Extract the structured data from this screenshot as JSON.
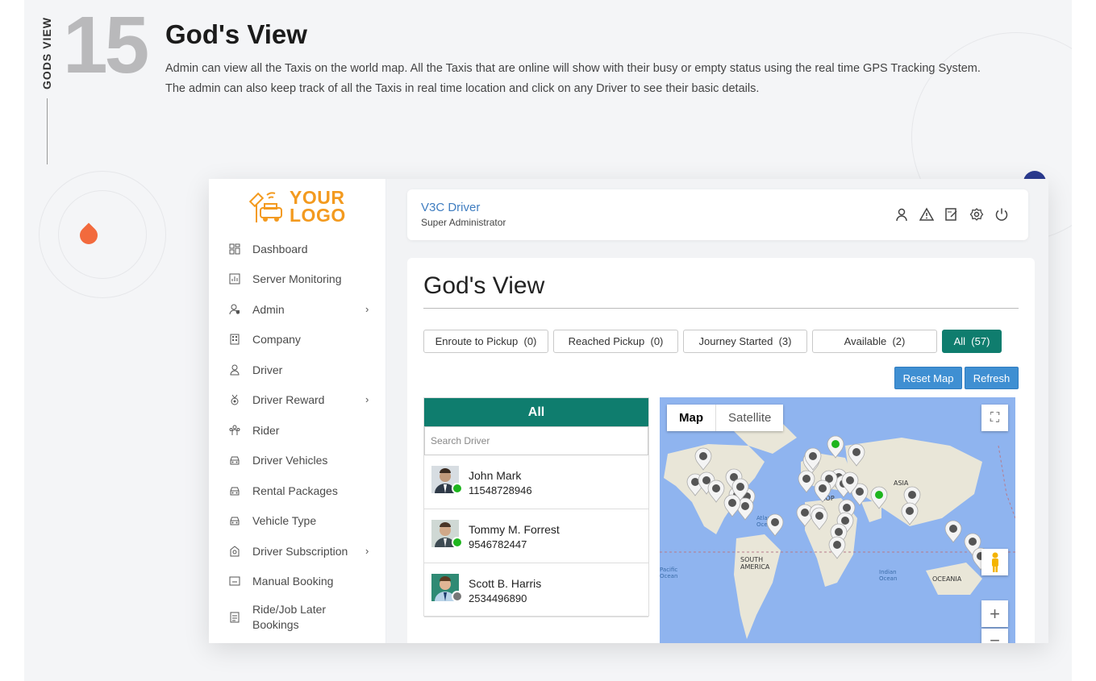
{
  "hero": {
    "side_label": "GODS VIEW",
    "number": "15",
    "title": "God's View",
    "description": "Admin can view all the Taxis on the world map. All the Taxis that are online will show with their busy or empty status using the real time GPS Tracking System. The admin can also keep track of all the Taxis in real time location and click on any Driver to see their basic details."
  },
  "logo": {
    "line1": "YOUR",
    "line2": "LOGO"
  },
  "sidebar": {
    "items": [
      {
        "label": "Dashboard",
        "icon": "dashboard-icon"
      },
      {
        "label": "Server Monitoring",
        "icon": "chart-icon"
      },
      {
        "label": "Admin",
        "icon": "admin-icon",
        "has_submenu": true
      },
      {
        "label": "Company",
        "icon": "building-icon"
      },
      {
        "label": "Driver",
        "icon": "driver-icon"
      },
      {
        "label": "Driver Reward",
        "icon": "medal-icon",
        "has_submenu": true
      },
      {
        "label": "Rider",
        "icon": "people-icon"
      },
      {
        "label": "Driver Vehicles",
        "icon": "car-icon"
      },
      {
        "label": "Rental Packages",
        "icon": "car-icon"
      },
      {
        "label": "Vehicle Type",
        "icon": "car-icon"
      },
      {
        "label": "Driver Subscription",
        "icon": "subscription-icon",
        "has_submenu": true
      },
      {
        "label": "Manual Booking",
        "icon": "booking-icon"
      },
      {
        "label": "Ride/Job Later Bookings",
        "icon": "document-icon"
      }
    ]
  },
  "topbar": {
    "user_name": "V3C Driver",
    "user_role": "Super Administrator"
  },
  "main": {
    "title": "God's View",
    "filters": [
      {
        "label": "Enroute to Pickup",
        "count": "(0)"
      },
      {
        "label": "Reached Pickup",
        "count": "(0)"
      },
      {
        "label": "Journey Started",
        "count": "(3)"
      },
      {
        "label": "Available",
        "count": "(2)"
      },
      {
        "label": "All",
        "count": "(57)"
      }
    ],
    "reset_map_label": "Reset Map",
    "refresh_label": "Refresh"
  },
  "driver_list": {
    "header": "All",
    "search_placeholder": "Search Driver",
    "drivers": [
      {
        "name": "John Mark",
        "phone": "11548728946",
        "status": "online"
      },
      {
        "name": "Tommy M. Forrest",
        "phone": "9546782447",
        "status": "online"
      },
      {
        "name": "Scott B. Harris",
        "phone": "2534496890",
        "status": "offline"
      }
    ]
  },
  "map": {
    "tabs": [
      "Map",
      "Satellite"
    ],
    "labels": {
      "asia": "ASIA",
      "atlantic": "Atlantic Ocean",
      "south_america": "SOUTH AMERICA",
      "pacific": "Pacific Ocean",
      "indian": "Indian Ocean",
      "oceania": "OCEANIA",
      "europe": "ROP"
    },
    "zoom_in": "+",
    "zoom_out": "−"
  },
  "colors": {
    "accent_teal": "#0f7d6e",
    "button_blue": "#3f8fd2",
    "logo_orange": "#f39a1f",
    "online_green": "#1eb51e",
    "offline_gray": "#777777"
  }
}
